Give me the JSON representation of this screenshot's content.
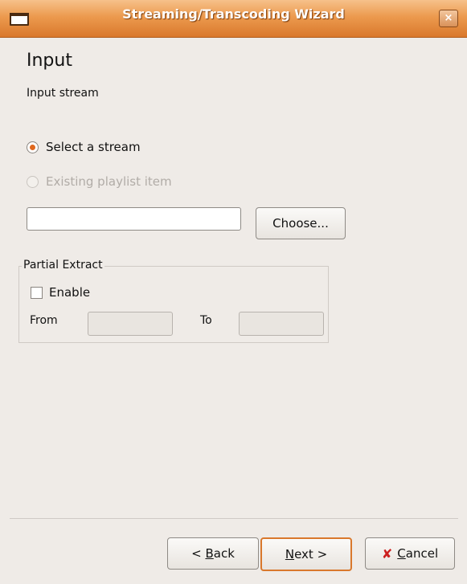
{
  "window": {
    "title": "Streaming/Transcoding Wizard",
    "close_label": "×"
  },
  "page": {
    "heading": "Input",
    "subheading": "Input stream"
  },
  "source": {
    "option_stream": "Select a stream",
    "option_playlist": "Existing playlist item",
    "selected": "Select a stream",
    "stream_value": "",
    "choose_label": "Choose..."
  },
  "partial_extract": {
    "legend": "Partial Extract",
    "enable_label": "Enable",
    "enable_checked": false,
    "from_label": "From",
    "to_label": "To",
    "from_value": "",
    "to_value": ""
  },
  "footer": {
    "back_label_prefix": "< ",
    "back_mnemonic": "B",
    "back_rest": "ack",
    "next_mnemonic": "N",
    "next_rest": "ext >",
    "cancel_mnemonic": "C",
    "cancel_rest": "ancel",
    "cancel_icon": "cancel-x-icon"
  }
}
